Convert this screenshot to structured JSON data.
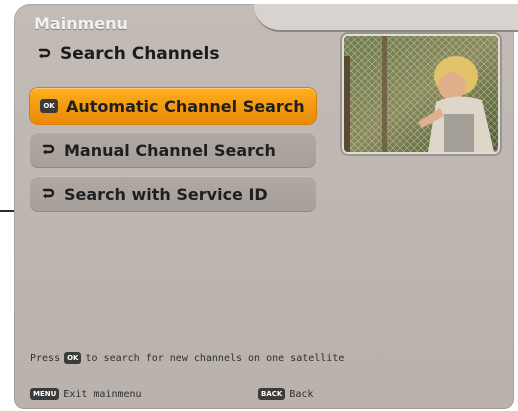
{
  "header": {
    "title": "Mainmenu",
    "subtitle": "Search Channels",
    "subtitle_icon": "curved-arrow-icon"
  },
  "menu": {
    "items": [
      {
        "label": "Automatic Channel Search",
        "selected": true,
        "icon": "ok-badge-icon",
        "icon_text": "OK"
      },
      {
        "label": "Manual Channel Search",
        "selected": false,
        "icon": "curved-arrow-icon"
      },
      {
        "label": "Search with Service ID",
        "selected": false,
        "icon": "curved-arrow-icon"
      }
    ]
  },
  "preview": {
    "icon": "tv-preview-image"
  },
  "hint": {
    "prefix": "Press",
    "key": "OK",
    "suffix": "to search for new channels on one satellite"
  },
  "footer": {
    "left_key": "MENU",
    "left_label": "Exit mainmenu",
    "right_key": "BACK",
    "right_label": "Back"
  },
  "colors": {
    "panel": "#bfb8b2",
    "selected": "#f39a10",
    "item": "#aca49f",
    "text": "#1f1f1f"
  }
}
